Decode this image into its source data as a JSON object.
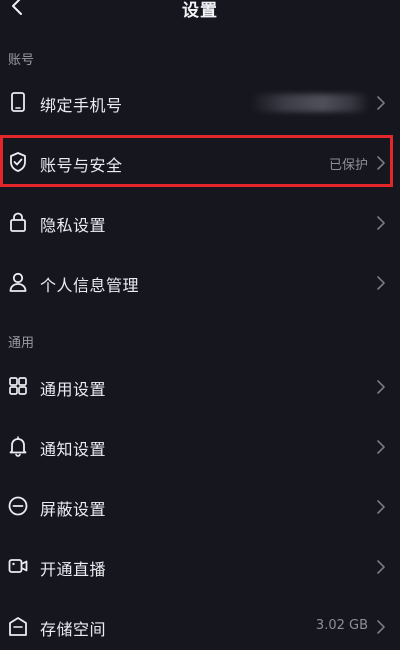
{
  "header": {
    "title": "设置",
    "back_icon": "chevron-left-icon"
  },
  "sections": {
    "account": {
      "label": "账号"
    },
    "general": {
      "label": "通用"
    }
  },
  "items": {
    "bind_phone": {
      "label": "绑定手机号",
      "value": "",
      "value_blurred": true,
      "icon": "phone-icon"
    },
    "account_security": {
      "label": "账号与安全",
      "value": "已保护",
      "icon": "shield-icon",
      "highlighted": true
    },
    "privacy": {
      "label": "隐私设置",
      "icon": "lock-icon"
    },
    "personal_info": {
      "label": "个人信息管理",
      "icon": "person-icon"
    },
    "general_settings": {
      "label": "通用设置",
      "icon": "grid-icon"
    },
    "notification": {
      "label": "通知设置",
      "icon": "bell-icon"
    },
    "block": {
      "label": "屏蔽设置",
      "icon": "block-icon"
    },
    "live": {
      "label": "开通直播",
      "icon": "video-icon"
    },
    "storage": {
      "label": "存储空间",
      "value": "3.02 GB",
      "icon": "storage-icon"
    }
  },
  "colors": {
    "background": "#16161f",
    "highlight": "#e2262a",
    "text": "#ececf0",
    "secondary_text": "#8e8e98"
  }
}
